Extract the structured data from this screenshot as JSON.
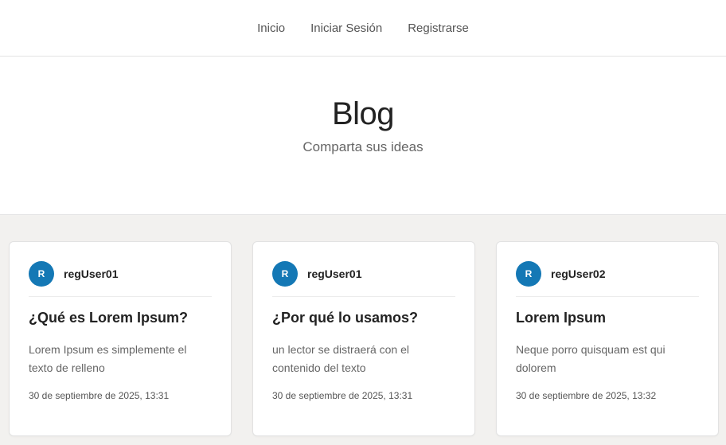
{
  "nav": {
    "items": [
      {
        "label": "Inicio"
      },
      {
        "label": "Iniciar Sesión"
      },
      {
        "label": "Registrarse"
      }
    ]
  },
  "hero": {
    "title": "Blog",
    "subtitle": "Comparta sus ideas"
  },
  "posts": [
    {
      "avatar_initial": "R",
      "author": "regUser01",
      "title": "¿Qué es Lorem Ipsum?",
      "excerpt": "Lorem Ipsum es simplemente el texto de relleno",
      "date": "30 de septiembre de 2025, 13:31"
    },
    {
      "avatar_initial": "R",
      "author": "regUser01",
      "title": "¿Por qué lo usamos?",
      "excerpt": "un lector se distraerá con el contenido del texto",
      "date": "30 de septiembre de 2025, 13:31"
    },
    {
      "avatar_initial": "R",
      "author": "regUser02",
      "title": "Lorem Ipsum",
      "excerpt": "Neque porro quisquam est qui dolorem",
      "date": "30 de septiembre de 2025, 13:32"
    }
  ],
  "colors": {
    "avatar": "#1478b5",
    "content_background": "#f2f1ef"
  }
}
